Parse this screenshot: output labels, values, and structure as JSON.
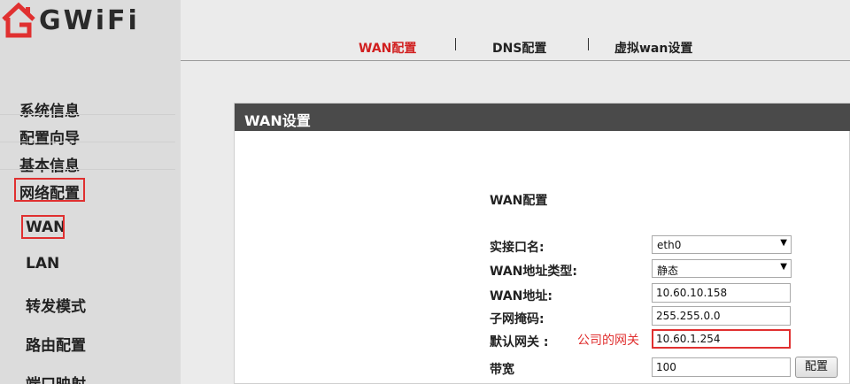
{
  "brand": {
    "logo_text": "GWiFi",
    "accent_color": "#e03030"
  },
  "sidebar": {
    "items": [
      {
        "label": "系统信息"
      },
      {
        "label": "配置向导"
      },
      {
        "label": "基本信息"
      },
      {
        "label": "网络配置"
      }
    ],
    "subitems": [
      {
        "label": "WAN"
      },
      {
        "label": "LAN"
      },
      {
        "label": "转发模式"
      },
      {
        "label": "路由配置"
      },
      {
        "label": "端口映射"
      }
    ]
  },
  "tabs": [
    {
      "label": "WAN配置",
      "active": true
    },
    {
      "label": "DNS配置",
      "active": false
    },
    {
      "label": "虚拟wan设置",
      "active": false
    }
  ],
  "panel": {
    "title": "WAN设置",
    "section_title": "WAN配置"
  },
  "form": {
    "interface": {
      "label": "实接口名:",
      "value": "eth0"
    },
    "addr_type": {
      "label": "WAN地址类型:",
      "value": "静态"
    },
    "wan_addr": {
      "label": "WAN地址:",
      "value": "10.60.10.158"
    },
    "subnet": {
      "label": "子网掩码:",
      "value": "255.255.0.0"
    },
    "gateway": {
      "label": "默认网关 :",
      "value": "10.60.1.254",
      "annotation": "公司的网关"
    },
    "bandwidth": {
      "label": "带宽",
      "value": "100"
    },
    "config_button": "配置"
  }
}
